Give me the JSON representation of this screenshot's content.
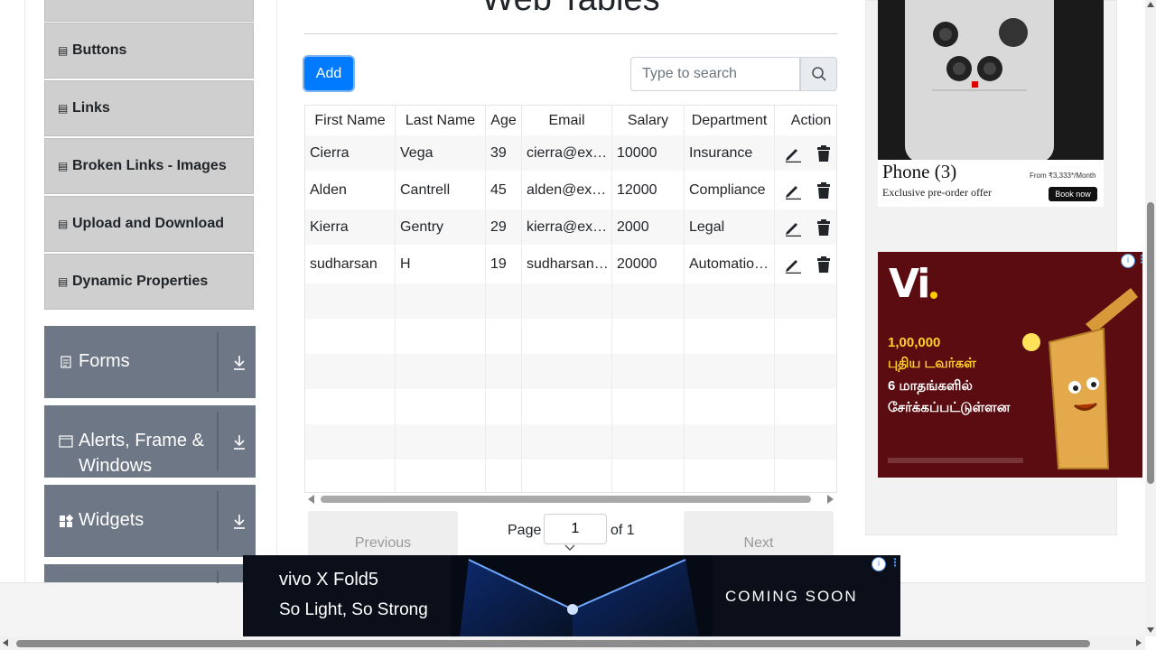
{
  "page": {
    "title": "Web Tables"
  },
  "sidebar": {
    "sub_items": [
      {
        "label": "Buttons"
      },
      {
        "label": "Links"
      },
      {
        "label": "Broken Links - Images"
      },
      {
        "label": "Upload and Download"
      },
      {
        "label": "Dynamic Properties"
      }
    ],
    "groups": [
      {
        "label": "Forms"
      },
      {
        "label": "Alerts, Frame & Windows"
      },
      {
        "label": "Widgets"
      }
    ]
  },
  "toolbar": {
    "add_label": "Add",
    "search_placeholder": "Type to search"
  },
  "table": {
    "headers": [
      "First Name",
      "Last Name",
      "Age",
      "Email",
      "Salary",
      "Department",
      "Action"
    ],
    "rows": [
      {
        "first": "Cierra",
        "last": "Vega",
        "age": "39",
        "email": "cierra@ex…",
        "salary": "10000",
        "dept": "Insurance"
      },
      {
        "first": "Alden",
        "last": "Cantrell",
        "age": "45",
        "email": "alden@ex…",
        "salary": "12000",
        "dept": "Compliance"
      },
      {
        "first": "Kierra",
        "last": "Gentry",
        "age": "29",
        "email": "kierra@ex…",
        "salary": "2000",
        "dept": "Legal"
      },
      {
        "first": "sudharsan",
        "last": "H",
        "age": "19",
        "email": "sudharsan…",
        "salary": "20000",
        "dept": "Automatio…"
      }
    ]
  },
  "pagination": {
    "previous": "Previous",
    "next": "Next",
    "page_label": "Page",
    "page_value": "1",
    "of_label": "of 1"
  },
  "ads": {
    "phone": {
      "title": "Phone (3)",
      "price": "From ₹3,333*/Month",
      "subtitle": "Exclusive pre-order offer",
      "cta": "Book now"
    },
    "vi": {
      "logo": "Vi",
      "line1": "1,00,000",
      "line2": "புதிய டவர்கள்",
      "line3": "6 மாதங்களில்",
      "line4": "சேர்க்கப்பட்டுள்ளன"
    },
    "vivo": {
      "brand": "vivo X Fold5",
      "tagline": "So Light, So Strong",
      "coming": "COMING SOON"
    }
  },
  "colors": {
    "accent": "#007bff",
    "sidebar_group": "#6d7785",
    "sidebar_item": "#cfcfcf",
    "vi_bg": "#5b0c10"
  },
  "icons": [
    "book-icon",
    "form-icon",
    "window-icon",
    "widgets-icon",
    "download-icon",
    "search-icon",
    "pencil-icon",
    "trash-icon",
    "ad-info-icon"
  ]
}
